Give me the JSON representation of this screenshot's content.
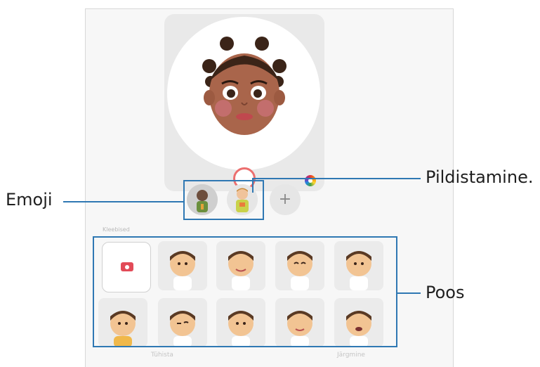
{
  "callouts": {
    "shutter_label": "Pildistamine.",
    "emoji_label": "Emoji",
    "poses_label": "Poos"
  },
  "stickers_section": {
    "title": "Kleebised",
    "count": 10
  },
  "bottom_bar": {
    "left_label": "Tühista",
    "right_label": "Järgmine"
  },
  "add_button_glyph": "+",
  "colors": {
    "accent_blue": "#2f78b3",
    "shutter_red": "#ec6f6f",
    "camera_red": "#e24b58"
  }
}
